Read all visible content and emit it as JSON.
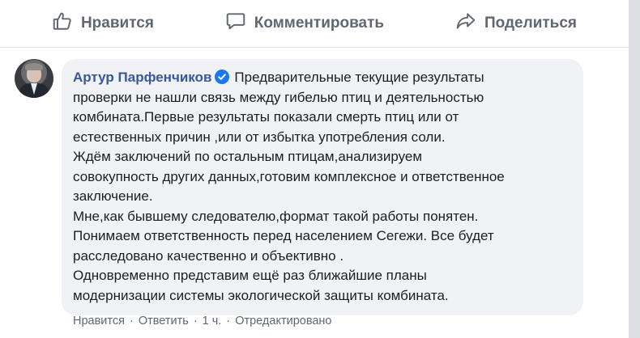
{
  "actions": {
    "like_label": "Нравится",
    "comment_label": "Комментировать",
    "share_label": "Поделиться"
  },
  "comment": {
    "author": "Артур Парфенчиков",
    "lines": [
      "Предварительные текущие результаты",
      "проверки не нашли связь между гибелью птиц и деятельностью",
      "комбината.Первые результаты показали смерть птиц или от",
      "естественных причин ,или от избытка употребления соли.",
      "Ждём заключений по остальным птицам,анализируем",
      "совокупность других данных,готовим комплексное и ответственное",
      "заключение.",
      "Мне,как бывшему следователю,формат такой работы понятен.",
      "Понимаем ответственность перед населением Сегежи. Все будет",
      "расследовано качественно и объективно .",
      "Одновременно представим ещё раз ближайшие планы",
      "модернизации системы экологической защиты комбината."
    ]
  },
  "meta": {
    "like": "Нравится",
    "reply": "Ответить",
    "time": "1 ч.",
    "edited": "Отредактировано",
    "separator": "·"
  },
  "colors": {
    "author": "#385898",
    "action_text": "#606770",
    "bubble_bg": "#f0f2f5",
    "verified": "#1877f2"
  }
}
